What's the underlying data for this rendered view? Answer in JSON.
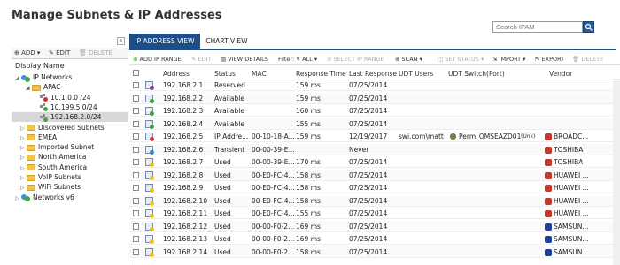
{
  "page": {
    "title": "Manage Subnets & IP Addresses",
    "search_placeholder": "Search IPAM"
  },
  "left": {
    "toolbar": {
      "add": "ADD ▾",
      "edit": "EDIT",
      "delete": "DELETE"
    },
    "display_name": "Display Name",
    "tree": [
      {
        "label": "IP Networks",
        "type": "globe",
        "exp": "◢"
      },
      {
        "label": "APAC",
        "type": "folder",
        "exp": "◢"
      },
      {
        "label": "10.1.0.0 /24",
        "type": "subnet",
        "status": "#e32b2b"
      },
      {
        "label": "10.199.5.0/24",
        "type": "subnet",
        "status": "#3fa63f"
      },
      {
        "label": "192.168.2.0/24",
        "type": "subnet",
        "status": "#3fa63f"
      },
      {
        "label": "Discovered Subnets",
        "type": "folder",
        "exp": "▷"
      },
      {
        "label": "EMEA",
        "type": "folder",
        "exp": "▷"
      },
      {
        "label": "Imported Subnet",
        "type": "folder",
        "exp": "▷"
      },
      {
        "label": "North America",
        "type": "folder",
        "exp": "▷"
      },
      {
        "label": "South America",
        "type": "folder",
        "exp": "▷"
      },
      {
        "label": "VoIP Subnets",
        "type": "folder",
        "exp": "▷"
      },
      {
        "label": "WiFi Subnets",
        "type": "folder",
        "exp": "▷"
      },
      {
        "label": "Networks v6",
        "type": "globe",
        "exp": "▷"
      }
    ]
  },
  "tabs": [
    "IP ADDRESS VIEW",
    "CHART VIEW"
  ],
  "toolbar": {
    "add": "ADD IP RANGE",
    "edit": "EDIT",
    "view": "VIEW DETAILS",
    "filter_label": "Filter:",
    "filter_value": "ALL ▾",
    "select": "SELECT IP RANGE",
    "scan": "SCAN ▾",
    "set_status": "SET STATUS ▾",
    "import": "IMPORT ▾",
    "export": "EXPORT",
    "delete": "DELETE"
  },
  "columns": [
    "Address",
    "Status",
    "MAC",
    "Response Time",
    "Last Response",
    "UDT Users",
    "UDT Switch(Port)",
    "Vendor"
  ],
  "rows": [
    {
      "addr": "192.168.2.1",
      "status": "Reserved",
      "mac": "",
      "rt": "159 ms",
      "last": "07/25/2014",
      "users": "",
      "switch": "",
      "vendor": "",
      "dot": "#8e44ad",
      "vcolor": ""
    },
    {
      "addr": "192.168.2.2",
      "status": "Available",
      "mac": "",
      "rt": "159 ms",
      "last": "07/25/2014",
      "users": "",
      "switch": "",
      "vendor": "",
      "dot": "#3fa63f",
      "vcolor": ""
    },
    {
      "addr": "192.168.2.3",
      "status": "Available",
      "mac": "",
      "rt": "160 ms",
      "last": "07/25/2014",
      "users": "",
      "switch": "",
      "vendor": "",
      "dot": "#3fa63f",
      "vcolor": ""
    },
    {
      "addr": "192.168.2.4",
      "status": "Available",
      "mac": "",
      "rt": "155 ms",
      "last": "07/25/2014",
      "users": "",
      "switch": "",
      "vendor": "",
      "dot": "#3fa63f",
      "vcolor": ""
    },
    {
      "addr": "192.168.2.5",
      "status": "IP Addre...",
      "mac": "00-10-18-A...",
      "rt": "159 ms",
      "last": "12/19/2017",
      "users": "swi.com\\matt",
      "switch": "Perm_OMSEAZD01",
      "switch_extra": "(Unk)",
      "vendor": "BROADC...",
      "dot": "#e32b2b",
      "vcolor": "#c0392b"
    },
    {
      "addr": "192.168.2.6",
      "status": "Transient",
      "mac": "00-00-39-E...",
      "rt": "",
      "last": "Never",
      "users": "",
      "switch": "",
      "vendor": "TOSHIBA",
      "dot": "#2e86de",
      "vcolor": "#c0392b"
    },
    {
      "addr": "192.168.2.7",
      "status": "Used",
      "mac": "00-00-39-E...",
      "rt": "170 ms",
      "last": "07/25/2014",
      "users": "",
      "switch": "",
      "vendor": "TOSHIBA",
      "dot": "#f1c40f",
      "vcolor": "#c0392b"
    },
    {
      "addr": "192.168.2.8",
      "status": "Used",
      "mac": "00-E0-FC-4...",
      "rt": "158 ms",
      "last": "07/25/2014",
      "users": "",
      "switch": "",
      "vendor": "HUAWEI ...",
      "dot": "#f1c40f",
      "vcolor": "#c0392b"
    },
    {
      "addr": "192.168.2.9",
      "status": "Used",
      "mac": "00-E0-FC-4...",
      "rt": "158 ms",
      "last": "07/25/2014",
      "users": "",
      "switch": "",
      "vendor": "HUAWEI ...",
      "dot": "#f1c40f",
      "vcolor": "#c0392b"
    },
    {
      "addr": "192.168.2.10",
      "status": "Used",
      "mac": "00-E0-FC-4...",
      "rt": "158 ms",
      "last": "07/25/2014",
      "users": "",
      "switch": "",
      "vendor": "HUAWEI ...",
      "dot": "#f1c40f",
      "vcolor": "#c0392b"
    },
    {
      "addr": "192.168.2.11",
      "status": "Used",
      "mac": "00-E0-FC-4...",
      "rt": "155 ms",
      "last": "07/25/2014",
      "users": "",
      "switch": "",
      "vendor": "HUAWEI ...",
      "dot": "#f1c40f",
      "vcolor": "#c0392b"
    },
    {
      "addr": "192.168.2.12",
      "status": "Used",
      "mac": "00-00-F0-2...",
      "rt": "169 ms",
      "last": "07/25/2014",
      "users": "",
      "switch": "",
      "vendor": "SAMSUN...",
      "dot": "#f1c40f",
      "vcolor": "#1f3f9a"
    },
    {
      "addr": "192.168.2.13",
      "status": "Used",
      "mac": "00-00-F0-2...",
      "rt": "169 ms",
      "last": "07/25/2014",
      "users": "",
      "switch": "",
      "vendor": "SAMSUN...",
      "dot": "#f1c40f",
      "vcolor": "#1f3f9a"
    },
    {
      "addr": "192.168.2.14",
      "status": "Used",
      "mac": "00-00-F0-2...",
      "rt": "158 ms",
      "last": "07/25/2014",
      "users": "",
      "switch": "",
      "vendor": "SAMSUN...",
      "dot": "#f1c40f",
      "vcolor": "#1f3f9a"
    }
  ]
}
